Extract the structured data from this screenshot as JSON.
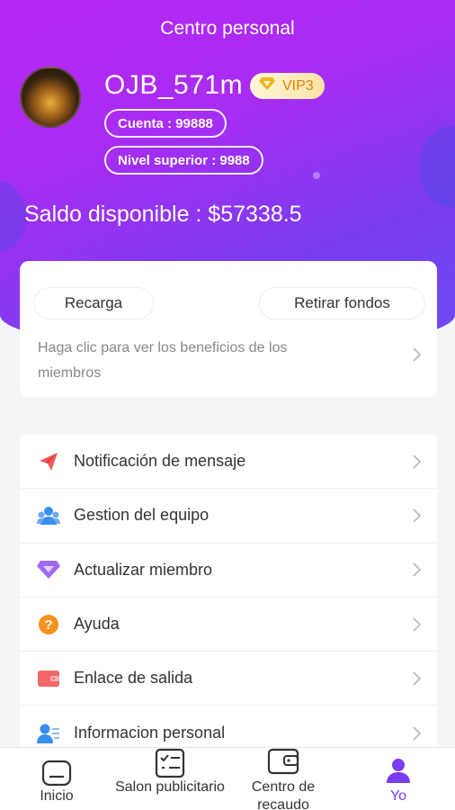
{
  "header": {
    "title": "Centro personal"
  },
  "profile": {
    "username": "OJB_571m",
    "vip_badge": "VIP3",
    "cuenta": "Cuenta : 99888",
    "nivel": "Nivel superior : 9988",
    "balance": "Saldo disponible : $57338.5"
  },
  "actions": {
    "recarga": "Recarga",
    "retirar": "Retirar fondos",
    "benefits_link": "Haga clic para ver los beneficios de los miembros"
  },
  "menu": {
    "items": [
      {
        "label": "Notificación de mensaje",
        "icon": "paper-plane-icon"
      },
      {
        "label": "Gestion del equipo",
        "icon": "team-icon"
      },
      {
        "label": "Actualizar miembro",
        "icon": "diamond-icon"
      },
      {
        "label": "Ayuda",
        "icon": "help-icon"
      },
      {
        "label": "Enlace de salida",
        "icon": "wallet-icon"
      },
      {
        "label": "Informacion personal",
        "icon": "person-info-icon"
      }
    ]
  },
  "tabbar": {
    "tabs": [
      {
        "label": "Inicio",
        "icon": "home-icon"
      },
      {
        "label": "Salon publicitario",
        "icon": "checklist-icon"
      },
      {
        "label": "Centro de recaudo",
        "icon": "wallet-icon"
      },
      {
        "label": "Yo",
        "icon": "user-icon",
        "active": true
      }
    ]
  },
  "colors": {
    "hero_start": "#b627f5",
    "hero_end": "#6a4cf2",
    "accent": "#7a3cf0",
    "vip_text": "#d9820e"
  }
}
